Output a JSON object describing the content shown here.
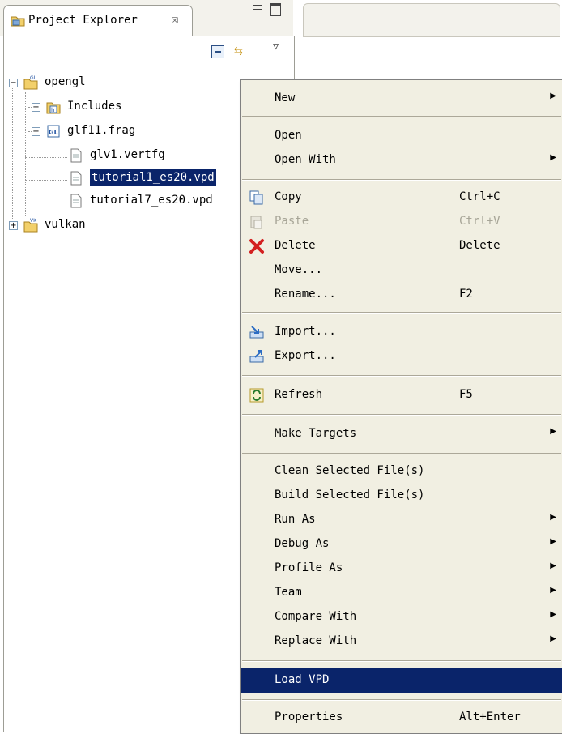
{
  "explorer": {
    "title": "Project Explorer",
    "close_glyph": "☒",
    "tree": [
      {
        "label": "opengl",
        "icon": "gl-project-icon"
      },
      {
        "label": "Includes",
        "icon": "includes-icon"
      },
      {
        "label": "glf11.frag",
        "icon": "gl-file-icon"
      },
      {
        "label": "glv1.vertfg",
        "icon": "file-icon"
      },
      {
        "label": "tutorial1_es20.vpd",
        "icon": "file-icon"
      },
      {
        "label": "tutorial7_es20.vpd",
        "icon": "file-icon"
      },
      {
        "label": "vulkan",
        "icon": "vk-project-icon"
      }
    ]
  },
  "menu": {
    "items": [
      {
        "label": "New",
        "shortcut": "",
        "submenu": true
      },
      {
        "label": "Open",
        "shortcut": ""
      },
      {
        "label": "Open With",
        "shortcut": "",
        "submenu": true
      },
      {
        "label": "Copy",
        "shortcut": "Ctrl+C",
        "icon": "copy-icon"
      },
      {
        "label": "Paste",
        "shortcut": "Ctrl+V",
        "icon": "paste-icon",
        "disabled": true
      },
      {
        "label": "Delete",
        "shortcut": "Delete",
        "icon": "delete-icon"
      },
      {
        "label": "Move...",
        "shortcut": ""
      },
      {
        "label": "Rename...",
        "shortcut": "F2"
      },
      {
        "label": "Import...",
        "shortcut": "",
        "icon": "import-icon"
      },
      {
        "label": "Export...",
        "shortcut": "",
        "icon": "export-icon"
      },
      {
        "label": "Refresh",
        "shortcut": "F5",
        "icon": "refresh-icon"
      },
      {
        "label": "Make Targets",
        "shortcut": "",
        "submenu": true
      },
      {
        "label": "Clean Selected File(s)",
        "shortcut": ""
      },
      {
        "label": "Build Selected File(s)",
        "shortcut": ""
      },
      {
        "label": "Run As",
        "shortcut": "",
        "submenu": true
      },
      {
        "label": "Debug As",
        "shortcut": "",
        "submenu": true
      },
      {
        "label": "Profile As",
        "shortcut": "",
        "submenu": true
      },
      {
        "label": "Team",
        "shortcut": "",
        "submenu": true
      },
      {
        "label": "Compare With",
        "shortcut": "",
        "submenu": true
      },
      {
        "label": "Replace With",
        "shortcut": "",
        "submenu": true
      },
      {
        "label": "Load VPD",
        "shortcut": "",
        "highlighted": true
      },
      {
        "label": "Properties",
        "shortcut": "Alt+Enter"
      }
    ],
    "arrow_glyph": "▶"
  },
  "colors": {
    "selection": "#0a246a",
    "menu_bg": "#f1efe2"
  }
}
